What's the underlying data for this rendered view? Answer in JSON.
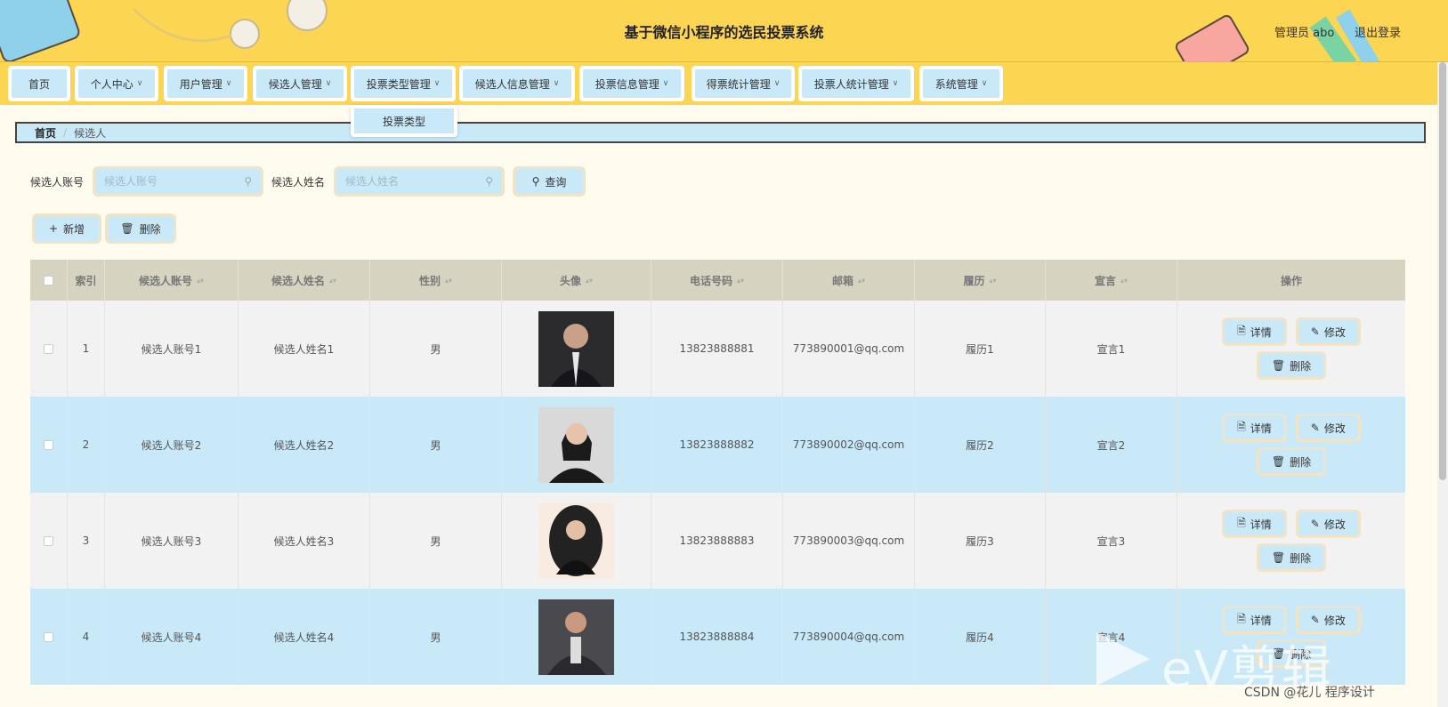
{
  "header": {
    "title": "基于微信小程序的选民投票系统",
    "admin_label": "管理员 abo",
    "logout_label": "退出登录"
  },
  "nav": {
    "items": [
      {
        "label": "首页",
        "has_dropdown": false
      },
      {
        "label": "个人中心",
        "has_dropdown": true
      },
      {
        "label": "用户管理",
        "has_dropdown": true
      },
      {
        "label": "候选人管理",
        "has_dropdown": true
      },
      {
        "label": "投票类型管理",
        "has_dropdown": true
      },
      {
        "label": "候选人信息管理",
        "has_dropdown": true
      },
      {
        "label": "投票信息管理",
        "has_dropdown": true
      },
      {
        "label": "得票统计管理",
        "has_dropdown": true
      },
      {
        "label": "投票人统计管理",
        "has_dropdown": true
      },
      {
        "label": "系统管理",
        "has_dropdown": true
      }
    ],
    "open_dropdown": {
      "parent": "投票类型管理",
      "items": [
        "投票类型"
      ]
    }
  },
  "breadcrumb": {
    "home": "首页",
    "current": "候选人"
  },
  "search": {
    "account_label": "候选人账号",
    "account_placeholder": "候选人账号",
    "name_label": "候选人姓名",
    "name_placeholder": "候选人姓名",
    "query_button": "查询"
  },
  "actions": {
    "add_button": "新增",
    "delete_button": "删除"
  },
  "table": {
    "columns": [
      "索引",
      "候选人账号",
      "候选人姓名",
      "性别",
      "头像",
      "电话号码",
      "邮箱",
      "履历",
      "宣言",
      "操作"
    ],
    "rows": [
      {
        "index": "1",
        "account": "候选人账号1",
        "name": "候选人姓名1",
        "gender": "男",
        "phone": "13823888881",
        "email": "773890001@qq.com",
        "resume": "履历1",
        "manifesto": "宣言1"
      },
      {
        "index": "2",
        "account": "候选人账号2",
        "name": "候选人姓名2",
        "gender": "男",
        "phone": "13823888882",
        "email": "773890002@qq.com",
        "resume": "履历2",
        "manifesto": "宣言2"
      },
      {
        "index": "3",
        "account": "候选人账号3",
        "name": "候选人姓名3",
        "gender": "男",
        "phone": "13823888883",
        "email": "773890003@qq.com",
        "resume": "履历3",
        "manifesto": "宣言3"
      },
      {
        "index": "4",
        "account": "候选人账号4",
        "name": "候选人姓名4",
        "gender": "男",
        "phone": "13823888884",
        "email": "773890004@qq.com",
        "resume": "履历4",
        "manifesto": "宣言4"
      }
    ],
    "row_buttons": {
      "detail": "详情",
      "edit": "修改",
      "delete": "删除"
    }
  },
  "watermark": {
    "editor": "eV剪辑",
    "csdn": "CSDN @花儿 程序设计"
  },
  "colors": {
    "header_bg": "#fcd553",
    "button_bg": "#c9e9f8",
    "button_border": "#efe4c8",
    "table_head": "#d6d3c0",
    "page_bg": "#fffcef"
  }
}
